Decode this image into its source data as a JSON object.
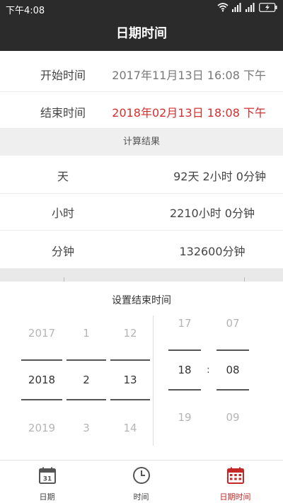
{
  "status": {
    "time": "下午4:08"
  },
  "app": {
    "title": "日期时间"
  },
  "dates": {
    "start_label": "开始时间",
    "start_value": "2017年11月13日 16:08 下午",
    "end_label": "结束时间",
    "end_value": "2018年02月13日 18:08 下午"
  },
  "section_title": "计算结果",
  "results": [
    {
      "label": "天",
      "value": "92天 2小时 0分钟"
    },
    {
      "label": "小时",
      "value": "2210小时 0分钟"
    },
    {
      "label": "分钟",
      "value": "132600分钟"
    }
  ],
  "picker": {
    "title": "设置结束时间",
    "date": {
      "prev": [
        "2017",
        "1",
        "12"
      ],
      "selected": [
        "2018",
        "2",
        "13"
      ],
      "next": [
        "2019",
        "3",
        "14"
      ]
    },
    "time": {
      "prev": [
        "17",
        "07"
      ],
      "selected": [
        "18",
        "08"
      ],
      "next": [
        "19",
        "09"
      ],
      "separator": ":"
    }
  },
  "tabs": [
    {
      "label": "日期",
      "icon": "calendar-31-icon",
      "icon_text": "31",
      "active": false
    },
    {
      "label": "时间",
      "icon": "clock-icon",
      "active": false
    },
    {
      "label": "日期时间",
      "icon": "calendar-grid-icon",
      "active": true
    }
  ],
  "colors": {
    "accent": "#c62828",
    "end_value": "#d32f2f",
    "appbar": "#2b2b2b"
  }
}
